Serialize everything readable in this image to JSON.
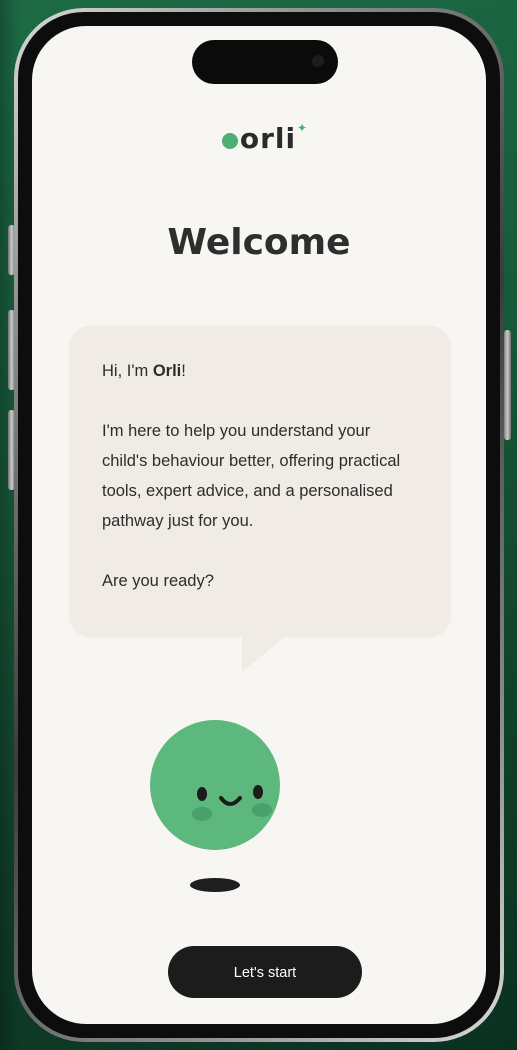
{
  "app": {
    "logo_text": "orli"
  },
  "screen": {
    "title": "Welcome",
    "message": {
      "greeting_prefix": "Hi, I'm ",
      "greeting_name": "Orli",
      "greeting_suffix": "!",
      "body": "I'm here to help you understand your child's behaviour better, offering practical tools, expert advice, and a personalised pathway just for you.",
      "question": "Are you ready?"
    },
    "start_button_label": "Let's start"
  },
  "colors": {
    "accent_green": "#4fae73",
    "mascot_green": "#5db87e",
    "button_dark": "#1c1c1c",
    "bubble_bg": "#f0ebe5"
  },
  "icons": {
    "mascot": "smiling-green-ball-mascot"
  }
}
